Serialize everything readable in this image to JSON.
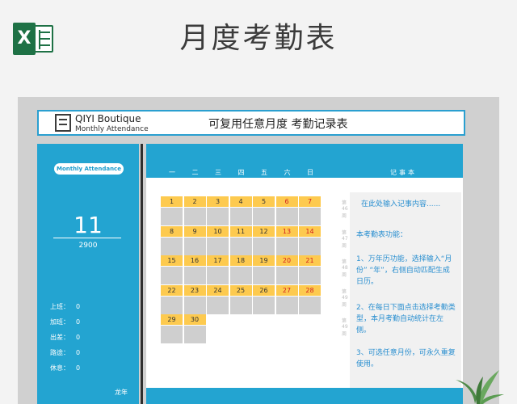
{
  "page": {
    "title": "月度考勤表"
  },
  "header": {
    "brand_name": "QIYI Boutique",
    "brand_sub": "Monthly Attendance",
    "sheet_title": "可复用任意月度  考勤记录表"
  },
  "sidebar": {
    "pill_label": "Monthly Attendance",
    "month": "11",
    "year": "2900",
    "stats": [
      {
        "label": "上班：",
        "value": "0"
      },
      {
        "label": "加班：",
        "value": "0"
      },
      {
        "label": "出差：",
        "value": "0"
      },
      {
        "label": "路途：",
        "value": "0"
      },
      {
        "label": "休息：",
        "value": "0"
      }
    ],
    "author": "龙年"
  },
  "calendar": {
    "weekdays": [
      "一",
      "二",
      "三",
      "四",
      "五",
      "六",
      "日"
    ],
    "weeks": [
      {
        "label": "第46周",
        "days": [
          "1",
          "2",
          "3",
          "4",
          "5",
          "6",
          "7"
        ]
      },
      {
        "label": "第47周",
        "days": [
          "8",
          "9",
          "10",
          "11",
          "12",
          "13",
          "14"
        ]
      },
      {
        "label": "第48周",
        "days": [
          "15",
          "16",
          "17",
          "18",
          "19",
          "20",
          "21"
        ]
      },
      {
        "label": "第49周",
        "days": [
          "22",
          "23",
          "24",
          "25",
          "26",
          "27",
          "28"
        ]
      },
      {
        "label": "第49周",
        "days": [
          "29",
          "30",
          "",
          "",
          "",
          "",
          ""
        ]
      }
    ],
    "weekend_color": "#d21f1f",
    "accent": "#23a4d1",
    "day_color": "#fdca4f"
  },
  "memo": {
    "header": "记事本",
    "placeholder": "在此处输入记事内容......",
    "lines": [
      "本考勤表功能：",
      "1、万年历功能，选择输入“月份” “年”，右侧自动匹配生成日历。",
      "2、在每日下面点击选择考勤类型，本月考勤自动统计在左侧。",
      "3、可选任意月份，可永久重复使用。"
    ]
  }
}
